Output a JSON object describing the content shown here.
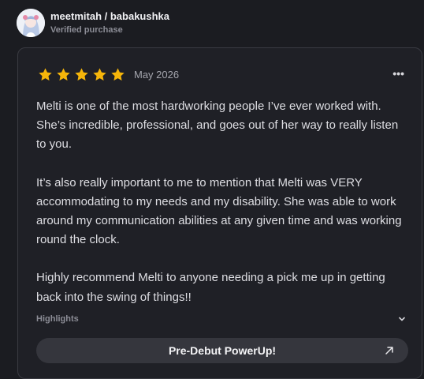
{
  "reviewer": {
    "name": "meetmitah / babakushka",
    "verified_label": "Verified purchase"
  },
  "review": {
    "rating": 5,
    "rating_max": 5,
    "date": "May 2026",
    "more_icon": "more-horizontal-icon",
    "paragraphs": [
      "Melti is one of the most hardworking people I’ve ever worked with. She’s incredible, professional, and goes out of her way to really listen to you.",
      "It’s also really important to me to mention that Melti was VERY accommodating to my needs and my disability. She was able to work around my communication abilities at any given time and was working round the clock.",
      "Highly recommend Melti to anyone needing a pick me up in getting back into the swing of things!!"
    ],
    "highlights_label": "Highlights",
    "product_label": "Pre-Debut PowerUp!"
  },
  "colors": {
    "background": "#1b1c21",
    "card": "#1f2026",
    "star": "#f5b50a",
    "button": "#35363d"
  }
}
